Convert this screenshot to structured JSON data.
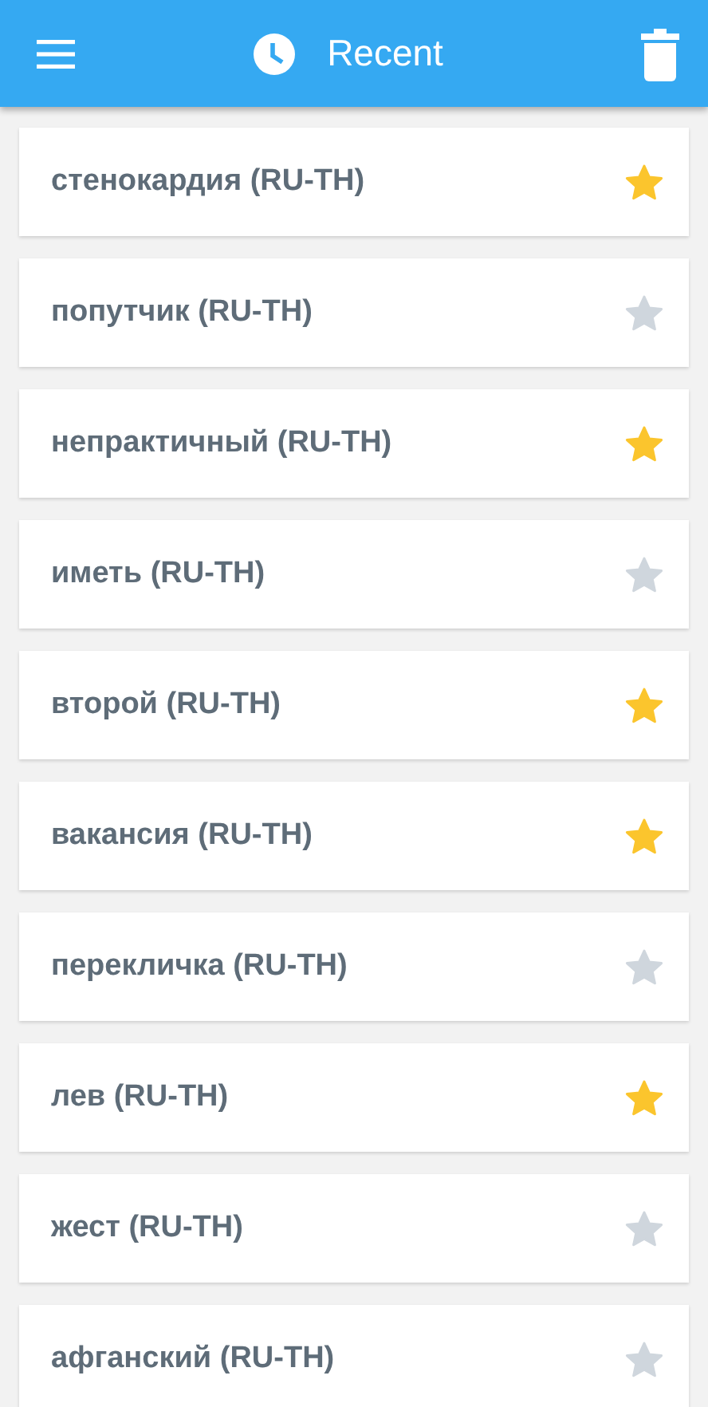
{
  "app_bar": {
    "title": "Recent"
  },
  "entries": [
    {
      "word": "стенокардия (RU-TH)",
      "favorite": true
    },
    {
      "word": "попутчик (RU-TH)",
      "favorite": false
    },
    {
      "word": "непрактичный (RU-TH)",
      "favorite": true
    },
    {
      "word": "иметь (RU-TH)",
      "favorite": false
    },
    {
      "word": "второй (RU-TH)",
      "favorite": true
    },
    {
      "word": "вакансия (RU-TH)",
      "favorite": true
    },
    {
      "word": "перекличка (RU-TH)",
      "favorite": false
    },
    {
      "word": "лев (RU-TH)",
      "favorite": true
    },
    {
      "word": "жест (RU-TH)",
      "favorite": false
    },
    {
      "word": "афганский (RU-TH)",
      "favorite": false
    }
  ]
}
